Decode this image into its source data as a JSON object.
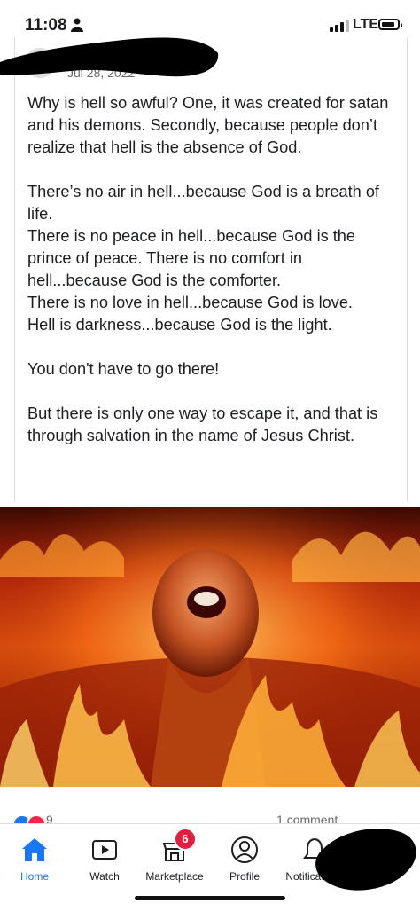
{
  "status_bar": {
    "time": "11:08",
    "network": "LTE"
  },
  "post": {
    "date": "Jul 28, 2022",
    "paragraphs": [
      [
        "Why is hell so awful? One, it was created for satan and his demons. Secondly, because people don’t realize that hell is the absence of God."
      ],
      [
        "There’s no air in hell...because God is a breath of life.",
        "There is no peace in hell...because God is the prince of peace. There is no comfort in hell...because God is the comforter.",
        "There is no love in hell...because God is love.",
        "Hell is darkness...because God is the light."
      ],
      [
        "You don't have to go there!"
      ],
      [
        "But there is only one way to escape it, and that is through salvation in the name of Jesus Christ."
      ]
    ],
    "image_subject": "person screaming engulfed in flames"
  },
  "reactions": {
    "count": "9",
    "comments": "1 comment"
  },
  "tabs": [
    {
      "label": "Home",
      "icon": "home-icon",
      "active": true
    },
    {
      "label": "Watch",
      "icon": "watch-icon",
      "active": false
    },
    {
      "label": "Marketplace",
      "icon": "marketplace-icon",
      "active": false,
      "badge": "6"
    },
    {
      "label": "Profile",
      "icon": "profile-icon",
      "active": false
    },
    {
      "label": "Notifications",
      "icon": "bell-icon",
      "active": false
    }
  ],
  "colors": {
    "accent": "#1877f2",
    "badge": "#e41e3f",
    "text": "#1c1e21"
  }
}
